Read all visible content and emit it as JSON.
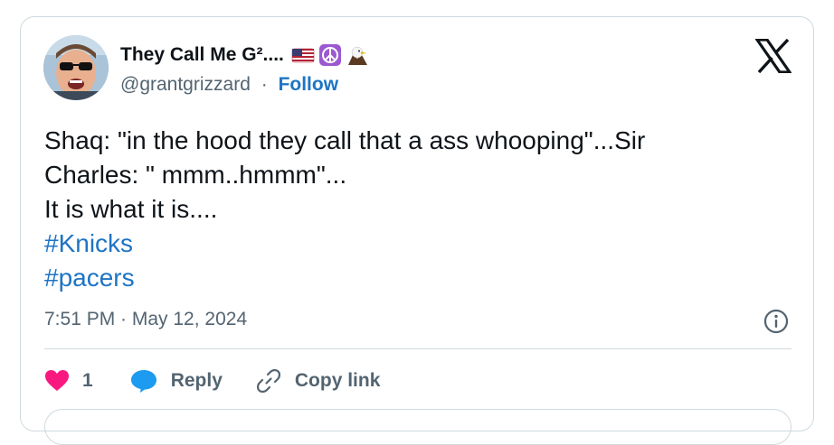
{
  "author": {
    "display_name": "They Call Me G²....",
    "handle": "@grantgrizzard",
    "separator": "·",
    "follow_label": "Follow",
    "emojis": [
      "us-flag-icon",
      "peace-symbol-icon",
      "eagle-icon"
    ]
  },
  "brand": {
    "logo": "x-logo-icon"
  },
  "tweet": {
    "lines": [
      "Shaq: \"in the hood they call that a ass whooping\"...Sir",
      "Charles: \" mmm..hmmm\"...",
      "It is what it is...."
    ],
    "hashtags": [
      "#Knicks",
      "#pacers"
    ],
    "timestamp": "7:51 PM · May 12, 2024"
  },
  "actions": {
    "like_count": "1",
    "reply_label": "Reply",
    "copy_link_label": "Copy link"
  },
  "colors": {
    "link_blue": "#1d74c4",
    "like_pink": "#f91880",
    "reply_blue": "#1d9bf0",
    "muted_gray": "#536471",
    "border": "#cfd9de"
  }
}
